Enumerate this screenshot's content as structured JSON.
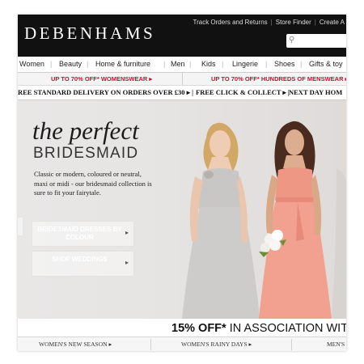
{
  "header": {
    "logo": "DEBENHAMS",
    "links": [
      "Track Orders and Returns",
      "Store Finder",
      "Create A"
    ]
  },
  "nav": {
    "items": [
      "Women",
      "Beauty",
      "Home & furniture",
      "Men",
      "Kids",
      "Lingerie",
      "Shoes",
      "Gifts & toy"
    ]
  },
  "promo": {
    "left": "UP TO 70% OFF* WOMENSWEAR",
    "right": "UP TO 70% OFF* HUNDREDS OF MENSWEAR"
  },
  "delivery": {
    "items": [
      "REE STANDARD DELIVERY ON ORDERS OVER £30",
      "FREE CLICK & COLLECT",
      "NEXT DAY HOM"
    ]
  },
  "hero": {
    "title_line1": "the perfect",
    "title_line2": "BRIDESMAID",
    "description": "Classic or modern, coloured or neutral, maxi or midi - our bridesmaid collection is sure to fit your fairytale.",
    "cta1": "BRIDESMAID DRESSES BY COLOUR",
    "cta2": "SHOP WEDDINGS"
  },
  "offer": {
    "bold": "15% OFF*",
    "text": " IN ASSOCIATION WITH"
  },
  "carousel": {
    "total": 3,
    "active": 0
  },
  "bottom_nav": {
    "items": [
      "WOMEN'S NEW SEASON",
      "WOMEN'S RAINY DAYS",
      "MEN'S"
    ]
  },
  "colors": {
    "brand_black": "#111111",
    "promo_red": "#c8102e",
    "active_dot": "#2d7fb3"
  }
}
